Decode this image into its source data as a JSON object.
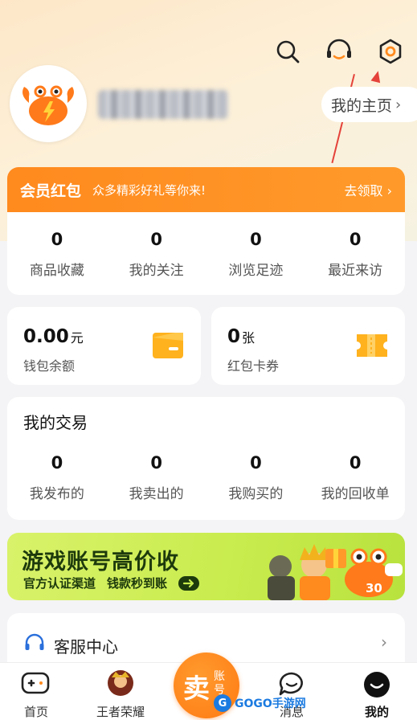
{
  "header": {
    "homepage_label": "我的主页",
    "homepage_chevron": "›"
  },
  "member": {
    "title": "会员红包",
    "subtitle": "众多精彩好礼等你来!",
    "action": "去领取",
    "action_chevron": "›",
    "stats": [
      {
        "value": "0",
        "label": "商品收藏"
      },
      {
        "value": "0",
        "label": "我的关注"
      },
      {
        "value": "0",
        "label": "浏览足迹"
      },
      {
        "value": "0",
        "label": "最近来访"
      }
    ]
  },
  "wallet": {
    "balance": "0.00",
    "balance_unit": "元",
    "balance_label": "钱包余额",
    "coupons": "0",
    "coupons_unit": "张",
    "coupons_label": "红包卡券"
  },
  "trade": {
    "title": "我的交易",
    "stats": [
      {
        "value": "0",
        "label": "我发布的"
      },
      {
        "value": "0",
        "label": "我卖出的"
      },
      {
        "value": "0",
        "label": "我购买的"
      },
      {
        "value": "0",
        "label": "我的回收单"
      }
    ]
  },
  "banner": {
    "title": "游戏账号高价收",
    "sub1": "官方认证渠道",
    "sub2": "钱款秒到账",
    "badge_number": "30"
  },
  "service": {
    "label": "客服中心",
    "chevron": "›"
  },
  "tabbar": {
    "tabs": [
      {
        "label": "首页",
        "icon": "gamepad-icon"
      },
      {
        "label": "王者荣耀",
        "icon": "hero-avatar-icon"
      },
      {
        "label": "消息",
        "icon": "chat-bubble-icon"
      },
      {
        "label": "我的",
        "icon": "profile-smile-icon"
      }
    ],
    "sell_big": "卖",
    "sell_small": "账号",
    "active_tab": "我的"
  },
  "watermark": {
    "text": "GOGO手游网"
  },
  "colors": {
    "accent": "#ff8a1e",
    "banner_green": "#c9ec4e",
    "annotation_red": "#e4423a"
  }
}
